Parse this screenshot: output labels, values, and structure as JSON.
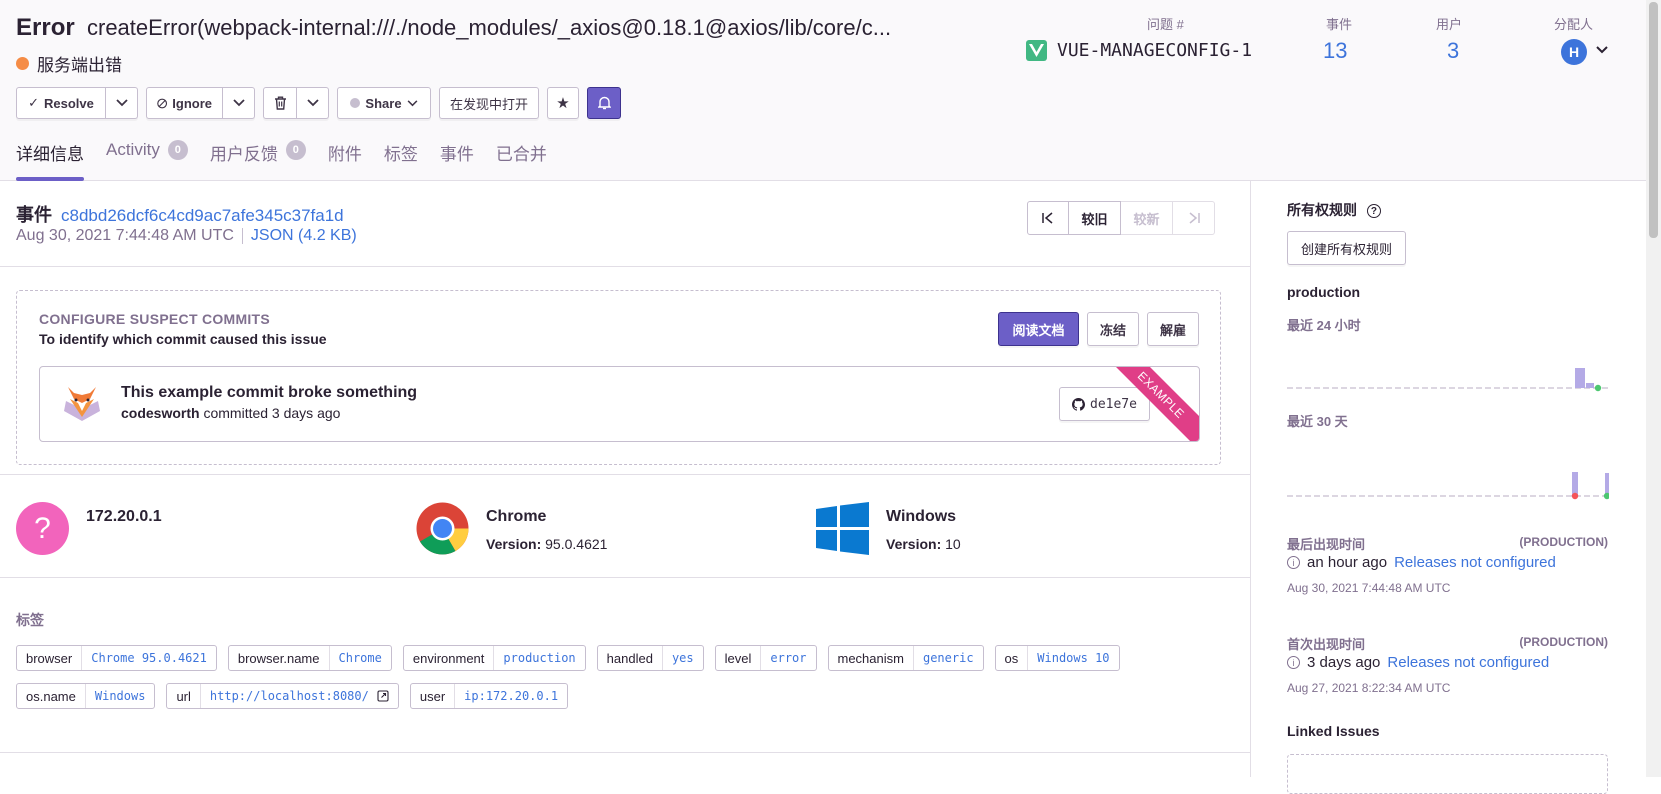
{
  "issue": {
    "type": "Error",
    "message": "createError(webpack-internal:///./node_modules/_axios@0.18.1@axios/lib/core/c...",
    "culprit": "服务端出错",
    "culprit_color": "#f58c46"
  },
  "stats": {
    "issue_label": "问题 #",
    "short_id": "VUE-MANAGECONFIG-1",
    "events_label": "事件",
    "events_value": "13",
    "users_label": "用户",
    "users_value": "3",
    "assignee_label": "分配人",
    "assignee_initial": "H"
  },
  "actions": {
    "resolve": "Resolve",
    "ignore": "Ignore",
    "share": "Share",
    "open_in_discover": "在发现中打开"
  },
  "tabs": [
    {
      "label": "详细信息",
      "active": true
    },
    {
      "label": "Activity",
      "badge": "0"
    },
    {
      "label": "用户反馈",
      "badge": "0"
    },
    {
      "label": "附件"
    },
    {
      "label": "标签"
    },
    {
      "label": "事件"
    },
    {
      "label": "已合并"
    }
  ],
  "event": {
    "label": "事件",
    "id": "c8dbd26dcf6c4cd9ac7afe345c37fa1d",
    "date": "Aug 30, 2021 7:44:48 AM UTC",
    "json_link": "JSON (4.2 KB)",
    "older": "较旧",
    "newer": "较新"
  },
  "suspect": {
    "title": "CONFIGURE SUSPECT COMMITS",
    "subtitle": "To identify which commit caused this issue",
    "read_docs": "阅读文档",
    "snooze": "冻结",
    "dismiss": "解雇",
    "commit_message": "This example commit broke something",
    "author": "codesworth",
    "committed": "committed 3 days ago",
    "sha": "de1e7e",
    "ribbon": "EXAMPLE"
  },
  "context": {
    "user": {
      "name": "172.20.0.1",
      "icon": "?"
    },
    "browser": {
      "name": "Chrome",
      "version_label": "Version:",
      "version": "95.0.4621"
    },
    "os": {
      "name": "Windows",
      "version_label": "Version:",
      "version": "10"
    }
  },
  "tags_section": {
    "title": "标签",
    "tags": [
      {
        "key": "browser",
        "value": "Chrome 95.0.4621"
      },
      {
        "key": "browser.name",
        "value": "Chrome"
      },
      {
        "key": "environment",
        "value": "production"
      },
      {
        "key": "handled",
        "value": "yes"
      },
      {
        "key": "level",
        "value": "error"
      },
      {
        "key": "mechanism",
        "value": "generic"
      },
      {
        "key": "os",
        "value": "Windows 10"
      },
      {
        "key": "os.name",
        "value": "Windows"
      },
      {
        "key": "url",
        "value": "http://localhost:8080/"
      },
      {
        "key": "user",
        "value": "ip:172.20.0.1"
      }
    ]
  },
  "sidebar": {
    "ownership_title": "所有权规则",
    "create_ownership": "创建所有权规则",
    "environment": "production",
    "last_24h": "最近 24 小时",
    "last_30d": "最近 30 天",
    "last_seen_label": "最后出现时间",
    "last_seen_env": "(PRODUCTION)",
    "last_seen_ago": "an hour ago",
    "last_seen_releases": "Releases not configured",
    "last_seen_date": "Aug 30, 2021 7:44:48 AM UTC",
    "first_seen_label": "首次出现时间",
    "first_seen_env": "(PRODUCTION)",
    "first_seen_ago": "3 days ago",
    "first_seen_releases": "Releases not configured",
    "first_seen_date": "Aug 27, 2021 8:22:34 AM UTC",
    "linked_issues": "Linked Issues"
  },
  "colors": {
    "accent": "#6c5fc7",
    "link": "#3d74db",
    "muted": "#80708f",
    "chart_bar": "#b4aae6",
    "chart_red": "#f55459",
    "chart_green": "#4dc771"
  }
}
